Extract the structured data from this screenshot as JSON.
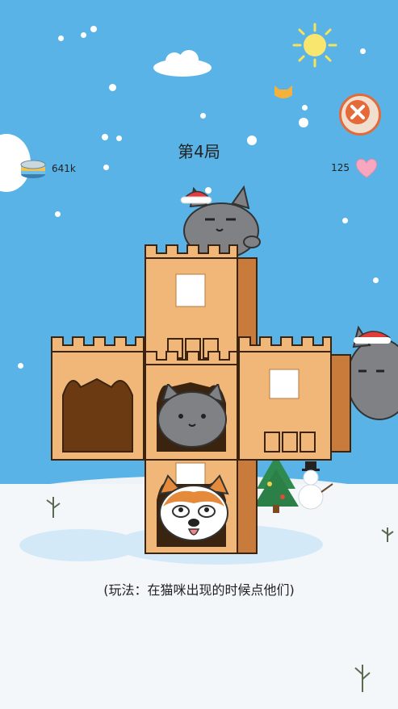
{
  "game": {
    "level_title": "第4局",
    "coins": "641k",
    "lives": "125",
    "instruction": "(玩法：在猫咪出现的时候点他们)"
  },
  "colors": {
    "sky": "#59b3e6",
    "box": "#f0b778",
    "box_dark": "#c97b3c",
    "heart": "#f7a8c0",
    "close": "#e46a3a"
  },
  "icons": [
    "sun-icon",
    "cloud-icon",
    "cat-head-icon",
    "close-icon",
    "coin-can-icon",
    "heart-icon"
  ]
}
